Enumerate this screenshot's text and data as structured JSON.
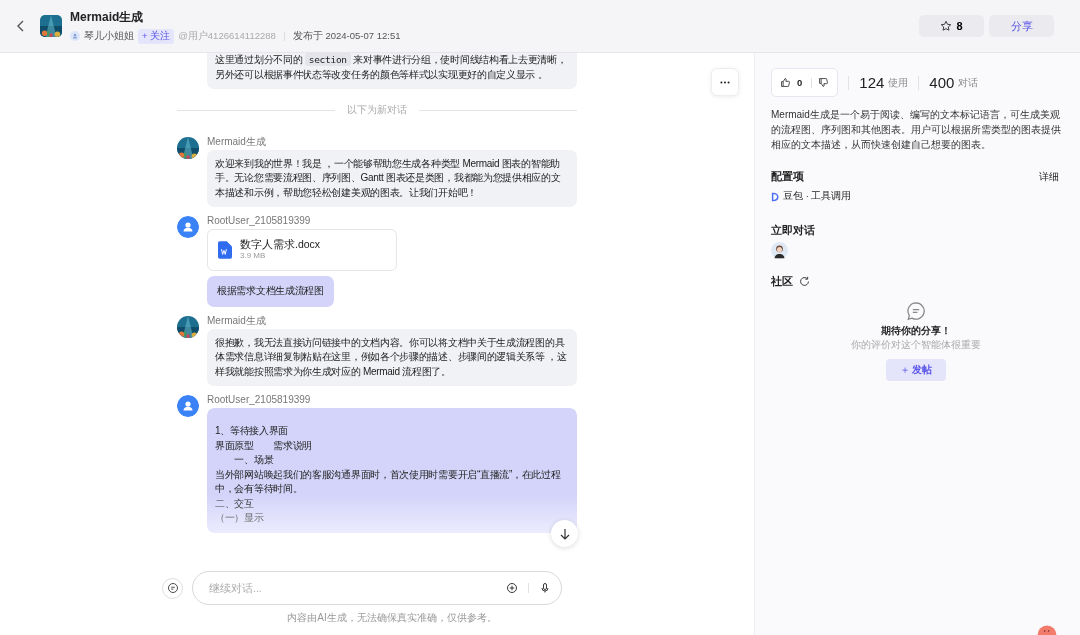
{
  "header": {
    "app_name": "Mermaid生成",
    "author": "琴儿小姐姐",
    "follow_label": "+ 关注",
    "user_id": "@用户4126614112288",
    "published": "发布于 2024-05-07 12:51",
    "star_count": "8",
    "share_label": "分享"
  },
  "chat": {
    "messages": [
      {
        "kind": "partial",
        "segments": [
          {
            "kind": "text",
            "text": "这里通过划分不同的 "
          },
          {
            "kind": "code",
            "text": "section"
          },
          {
            "kind": "text",
            "text": " 来对事件进行分组，使时间线结构看上去更清晰，另外还可以根据事件状态等改变任务的颜色等样式以实现更好的自定义显示 。"
          }
        ]
      },
      {
        "kind": "divider",
        "label": "以下为新对话"
      },
      {
        "kind": "bot",
        "sender": "Mermaid生成",
        "text": "欢迎来到我的世界！我是 ，一个能够帮助您生成各种类型 Mermaid 图表的智能助手。无论您需要流程图、序列图、Gantt 图表还是类图，我都能为您提供相应的文本描述和示例，帮助您轻松创建美观的图表。让我们开始吧！"
      },
      {
        "kind": "user",
        "sender": "RootUser_2105819399",
        "file": {
          "name": "数字人需求.docx",
          "size": "3.9 MB"
        },
        "lines": [
          "根据需求文档生成流程图"
        ]
      },
      {
        "kind": "bot",
        "sender": "Mermaid生成",
        "text": "很抱歉，我无法直接访问链接中的文档内容。你可以将文档中关于生成流程图的具体需求信息详细复制粘贴在这里，例如各个步骤的描述、步骤间的逻辑关系等 ，这样我就能按照需求为你生成对应的 Mermaid 流程图了。"
      },
      {
        "kind": "user_long",
        "sender": "RootUser_2105819399",
        "lines": [
          "1、等待接入界面",
          "界面原型　　需求说明",
          "　　一、场景",
          "当外部网站唤起我们的客服沟通界面时，首次使用时需要开启“直播流”，在此过程中，会有等待时间。",
          "二、交互",
          "（一）显示"
        ]
      }
    ],
    "input_placeholder": "继续对话...",
    "footnote": "内容由AI生成，无法确保真实准确，仅供参考。"
  },
  "panel": {
    "likes": "0",
    "uses_count": "124",
    "uses_label": "使用",
    "chats_count": "400",
    "chats_label": "对话",
    "description": "Mermaid生成是一个易于阅读、编写的文本标记语言，可生成美观的流程图、序列图和其他图表。用户可以根据所需类型的图表提供相应的文本描述，从而快速创建自己想要的图表。",
    "config_title": "配置项",
    "detail_link": "详细",
    "model_label": "豆包 · 工具调用",
    "chat_now_title": "立即对话",
    "community_title": "社区",
    "empty_title": "期待你的分享！",
    "empty_sub": "你的评价对这个智能体很重要",
    "post_label": "发帖",
    "post_icon": "＋"
  }
}
